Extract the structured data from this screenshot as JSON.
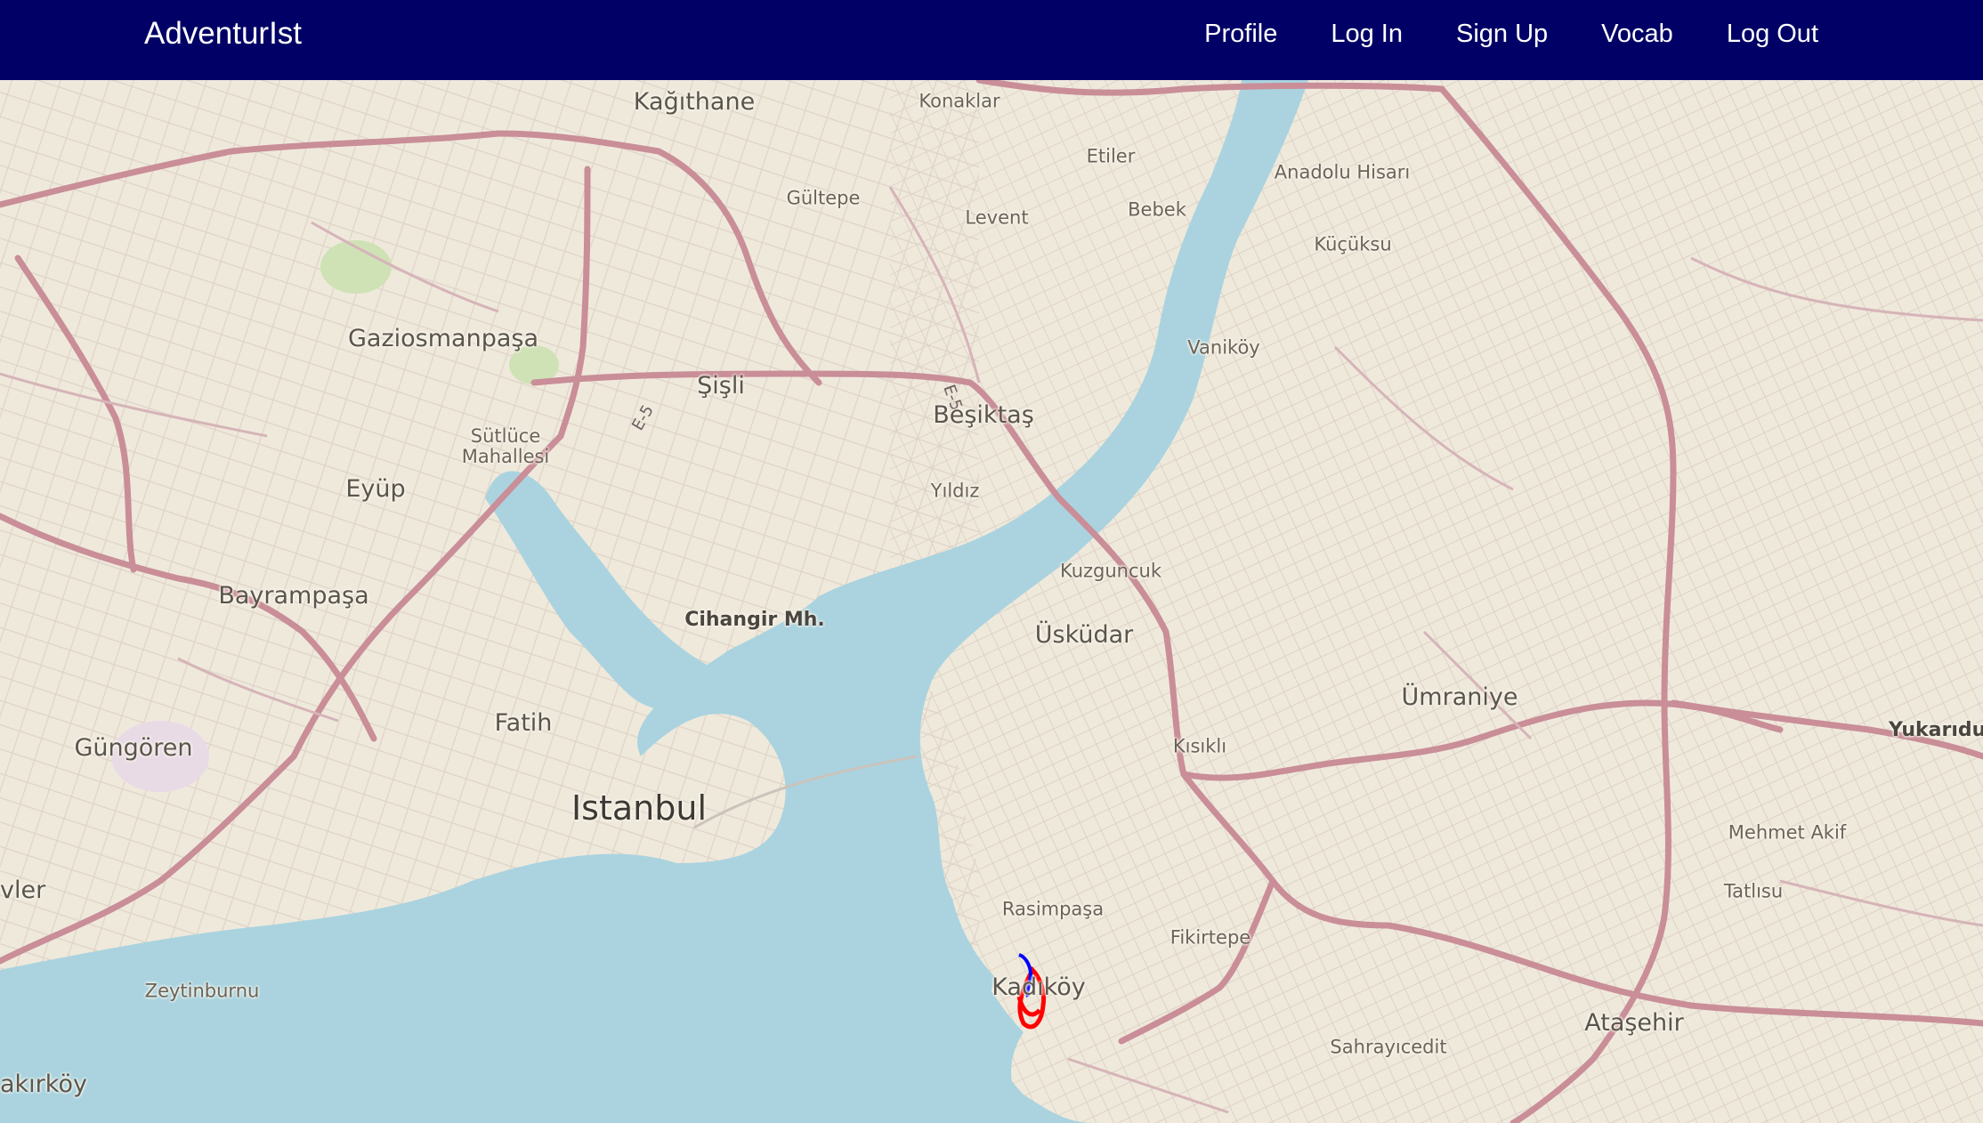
{
  "navbar": {
    "brand": "AdventurIst",
    "links": [
      "Profile",
      "Log In",
      "Sign Up",
      "Vocab",
      "Log Out"
    ]
  },
  "map": {
    "places": [
      {
        "name": "Kağıthane"
      },
      {
        "name": "Konaklar"
      },
      {
        "name": "Etiler"
      },
      {
        "name": "Anadolu Hisarı"
      },
      {
        "name": "Gültepe"
      },
      {
        "name": "Levent"
      },
      {
        "name": "Bebek"
      },
      {
        "name": "Küçüksu"
      },
      {
        "name": "Gaziosmanpaşa"
      },
      {
        "name": "Vaniköy"
      },
      {
        "name": "Şişli"
      },
      {
        "name": "Beşiktaş"
      },
      {
        "name": "Sütlüce Mahallesi"
      },
      {
        "name": "Eyüp"
      },
      {
        "name": "Yıldız"
      },
      {
        "name": "Kuzguncuk"
      },
      {
        "name": "Bayrampaşa"
      },
      {
        "name": "Cihangir Mh."
      },
      {
        "name": "Üsküdar"
      },
      {
        "name": "Ümraniye"
      },
      {
        "name": "Fatih"
      },
      {
        "name": "Güngören"
      },
      {
        "name": "Kısıklı"
      },
      {
        "name": "Yukarıdu"
      },
      {
        "name": "Istanbul"
      },
      {
        "name": "Mehmet Akif"
      },
      {
        "name": "vler"
      },
      {
        "name": "Tatlısu"
      },
      {
        "name": "Rasimpaşa"
      },
      {
        "name": "Fikirtepe"
      },
      {
        "name": "Zeytinburnu"
      },
      {
        "name": "Kadıköy"
      },
      {
        "name": "Ataşehir"
      },
      {
        "name": "Sahrayıcedit"
      },
      {
        "name": "akırköy"
      }
    ],
    "roads": [
      {
        "ref": "E-5"
      },
      {
        "ref": "E-5"
      }
    ],
    "colors": {
      "land": "#efe9dc",
      "water": "#aad3df",
      "major_road": "#c98e98",
      "park": "#c8e0b0",
      "route_blue": "#0000ff",
      "route_red": "#ff0000"
    }
  }
}
